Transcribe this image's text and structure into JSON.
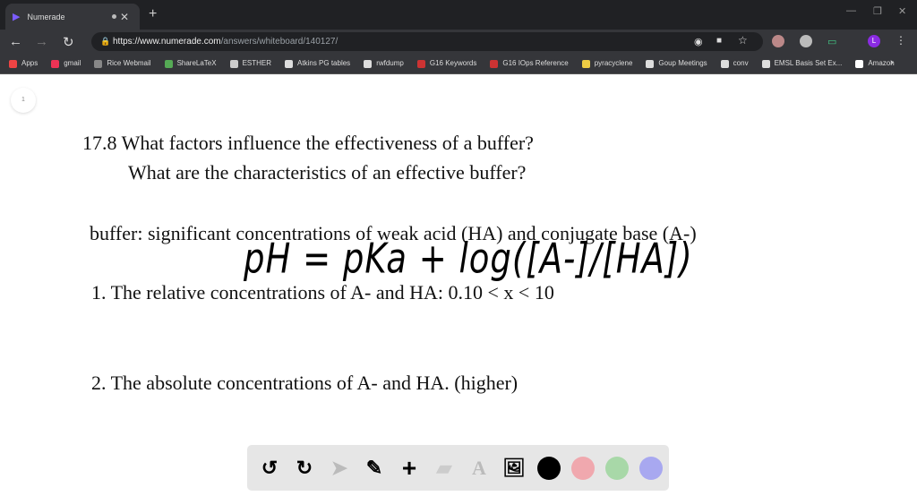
{
  "browser": {
    "tab_title": "Numerade",
    "url_host": "https://www.numerade.com",
    "url_path": "/answers/whiteboard/140127/",
    "profile_initial": "L",
    "bookmarks": [
      "Apps",
      "gmail",
      "Rice Webmail",
      "ShareLaTeX",
      "ESTHER",
      "Atkins PG tables",
      "rwfdump",
      "G16 Keywords",
      "G16 IOps Reference",
      "pyracyclene",
      "Goup Meetings",
      "conv",
      "EMSL Basis Set Ex...",
      "Amazon"
    ],
    "bookmark_colors": [
      "#e44",
      "#e35",
      "#888",
      "#5a5",
      "#ccc",
      "#ddd",
      "#ddd",
      "#c33",
      "#c33",
      "#ec4",
      "#ddd",
      "#ddd",
      "#ddd",
      "#fff"
    ]
  },
  "whiteboard": {
    "page_number": "1",
    "question_line1": "17.8 What factors influence the effectiveness of a buffer?",
    "question_line2": "What are the characteristics of an effective buffer?",
    "definition": "buffer: significant concentrations of weak acid (HA) and conjugate base (A-)",
    "point1": "1. The relative concentrations of A- and HA: 0.10 < x < 10",
    "point2": "2. The absolute concentrations of A- and HA. (higher)",
    "handwriting": "pH = pKa + log([A-]/[HA])"
  },
  "toolbar": {
    "tools": [
      "undo",
      "redo",
      "select",
      "pencil",
      "add",
      "eraser",
      "text",
      "image"
    ],
    "colors": [
      "#000000",
      "#f0a8ae",
      "#a8d8a8",
      "#a8a8f0"
    ]
  }
}
